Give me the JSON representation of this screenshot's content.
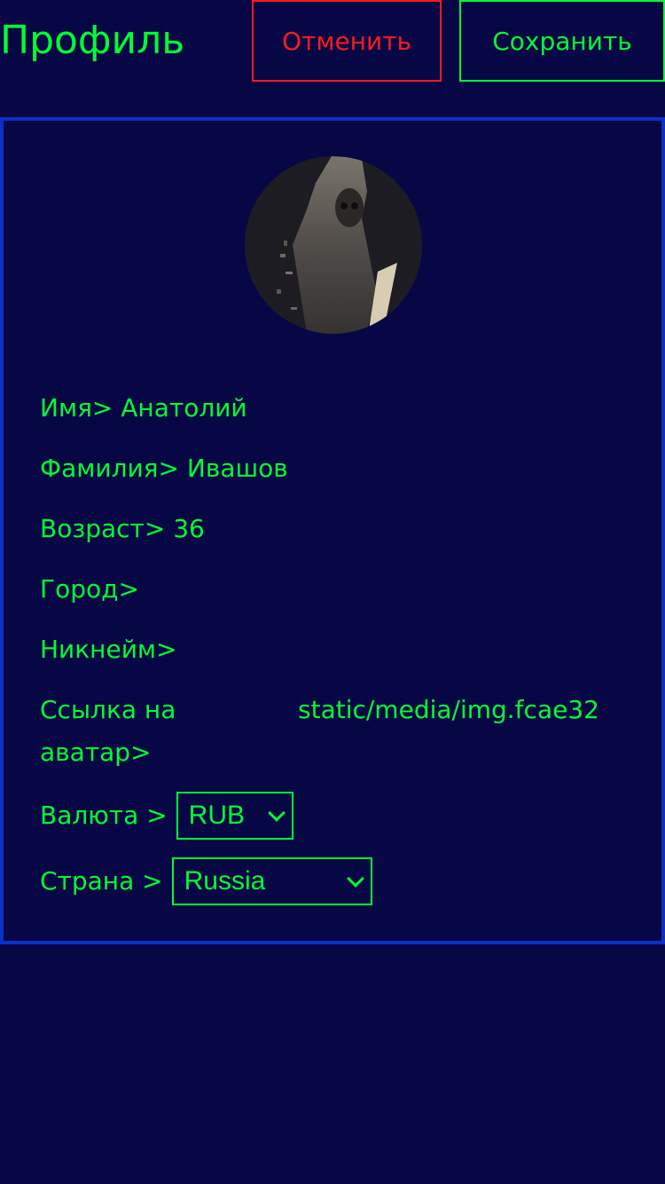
{
  "header": {
    "title": "Профиль",
    "cancel_label": "Отменить",
    "save_label": "Сохранить"
  },
  "profile": {
    "fields": [
      {
        "label": "Имя>",
        "value": "Анатолий"
      },
      {
        "label": "Фамилия>",
        "value": "Ивашов"
      },
      {
        "label": "Возраст>",
        "value": "36"
      },
      {
        "label": "Город>",
        "value": ""
      },
      {
        "label": "Никнейм>",
        "value": ""
      }
    ],
    "avatar_link": {
      "label": "Ссылка на аватар>",
      "value": "static/media/img.fcae32"
    },
    "currency": {
      "label": "Валюта >",
      "selected": "RUB"
    },
    "country": {
      "label": "Страна >",
      "selected": "Russia"
    }
  },
  "colors": {
    "background": "#070745",
    "text": "#00ff33",
    "cancel": "#ff1a1a",
    "card_border": "#0b2fc8"
  }
}
